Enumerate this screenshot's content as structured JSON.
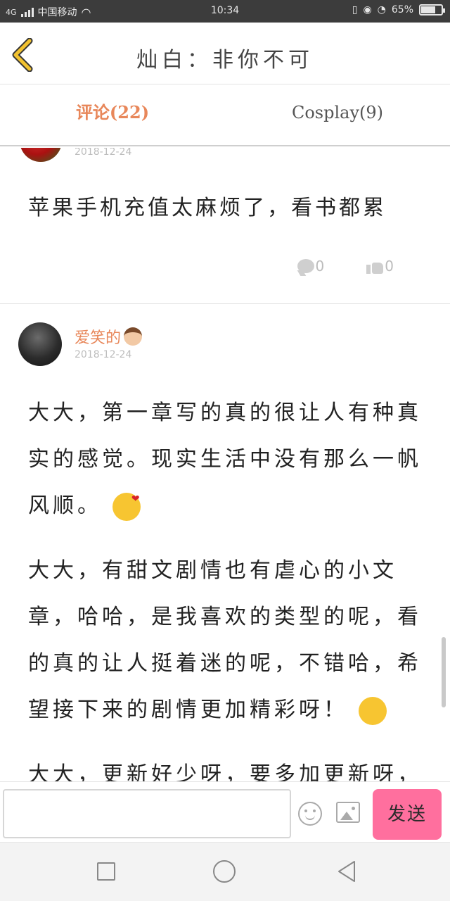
{
  "status_bar": {
    "network": "4G",
    "carrier": "中国移动",
    "time": "10:34",
    "battery_text": "65%",
    "battery_level": 0.65
  },
  "header": {
    "title": "灿白：非你不可"
  },
  "tabs": [
    {
      "label": "评论(22)",
      "active": true
    },
    {
      "label": "Cosplay(9)",
      "active": false
    }
  ],
  "comments": [
    {
      "date": "2018-12-24",
      "text": "苹果手机充值太麻烦了，看书都累",
      "reply_count": "0",
      "like_count": "0"
    },
    {
      "username": "爱笑的",
      "date": "2018-12-24",
      "paragraphs": [
        "大大，第一章写的真的很让人有种真实的感觉。现实生活中没有那么一帆风顺。",
        "大大，有甜文剧情也有虐心的小文章，哈哈，是我喜欢的类型的呢，看的真的让人挺着迷的呢，不错哈，希望接下来的剧情更加精彩呀！",
        "大大，更新好少呀，要多加更新呀，"
      ]
    }
  ],
  "input_bar": {
    "placeholder": "",
    "send_label": "发送"
  },
  "colors": {
    "accent": "#e8875a",
    "send_button": "#ff6f9e",
    "status_bar": "#3c3c3c"
  }
}
